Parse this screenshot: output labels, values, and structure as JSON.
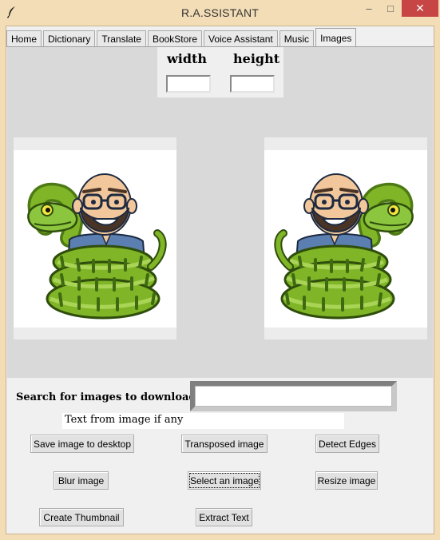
{
  "window": {
    "title": "R.A.SSISTANT",
    "minimize_glyph": "–",
    "maximize_glyph": "□",
    "close_glyph": "✕",
    "app_icon": "feather-icon"
  },
  "tabs": [
    {
      "label": "Home"
    },
    {
      "label": "Dictionary"
    },
    {
      "label": "Translate"
    },
    {
      "label": "BookStore"
    },
    {
      "label": "Voice Assistant"
    },
    {
      "label": "Music"
    },
    {
      "label": "Images",
      "active": true
    }
  ],
  "dimensions": {
    "width_label": "width",
    "height_label": "height",
    "width_value": "",
    "height_value": ""
  },
  "images": {
    "left_icon": "cartoon-man-with-snake-image",
    "right_icon": "cartoon-man-with-snake-image-mirrored"
  },
  "search": {
    "label": "Search for images to download",
    "value": ""
  },
  "text_result": "Text from image if any",
  "buttons": {
    "save": "Save image to desktop",
    "transpose": "Transposed image",
    "edges": "Detect Edges",
    "blur": "Blur image",
    "select": "Select an image",
    "resize": "Resize image",
    "thumbnail": "Create Thumbnail",
    "extract": "Extract Text"
  },
  "colors": {
    "titlebar": "#f2ddb6",
    "close_button": "#c74545",
    "image_area": "#d9d9d9",
    "snake_green": "#6fa61e",
    "skin": "#f2c79b",
    "shirt": "#5b7fb0"
  }
}
